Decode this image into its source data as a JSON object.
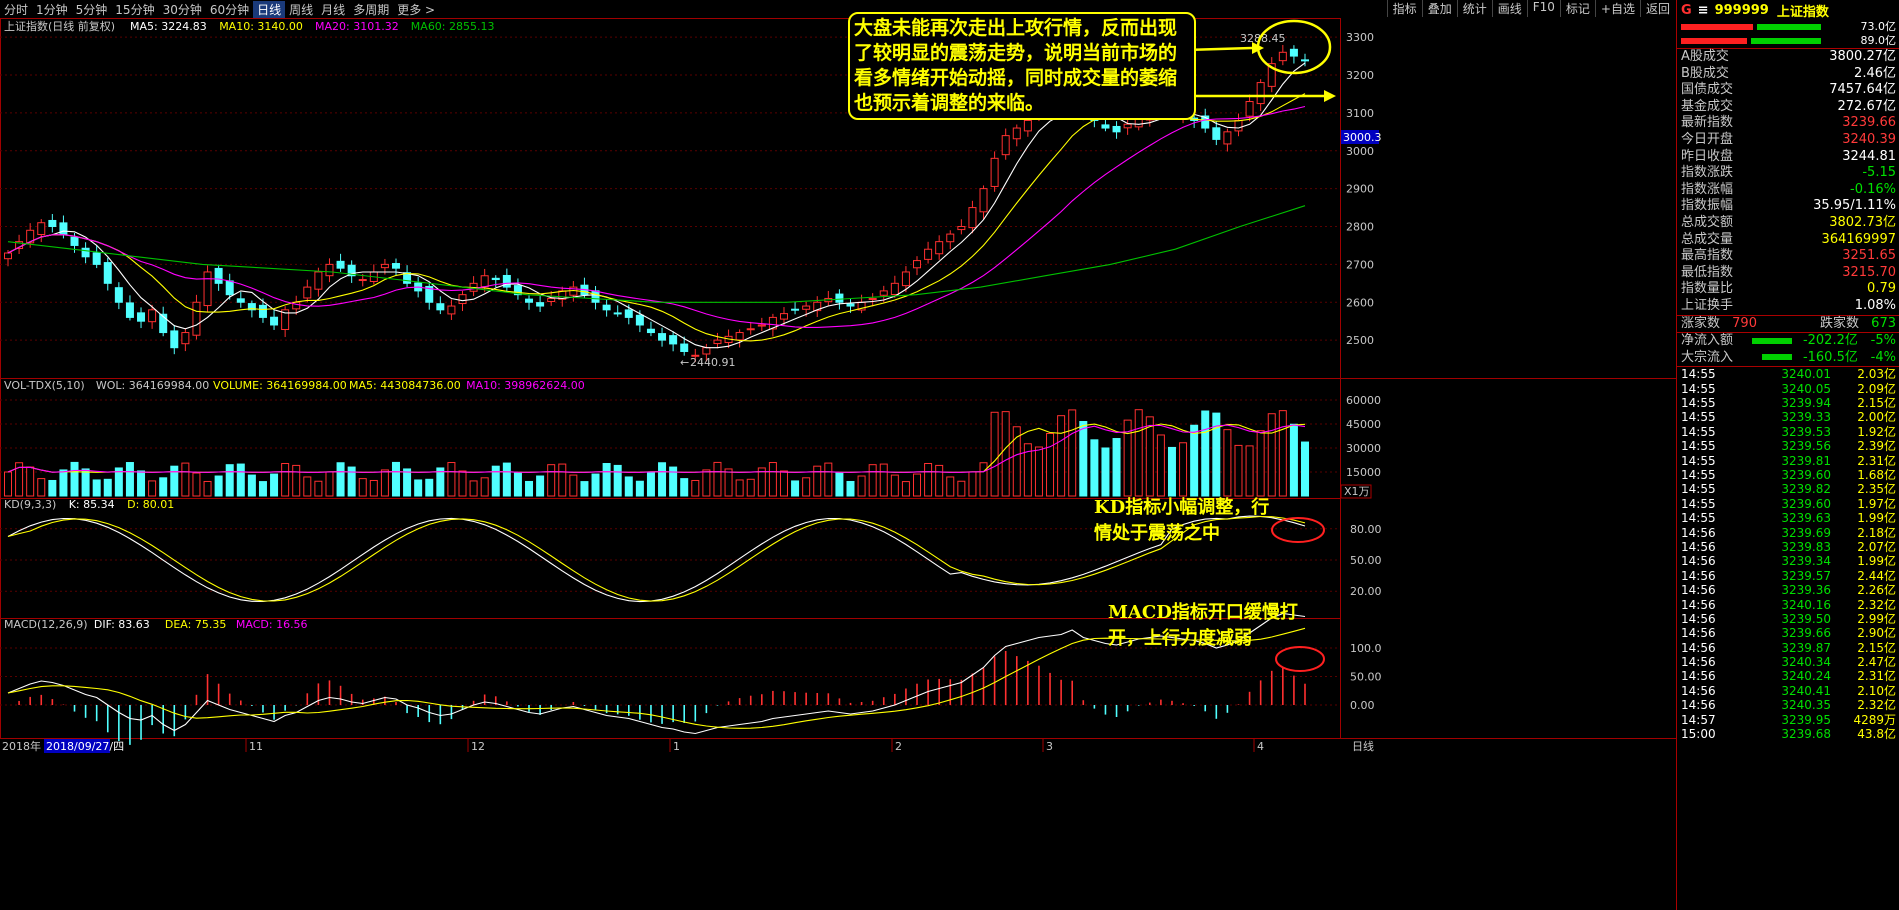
{
  "toolbar": {
    "left": [
      "分时",
      "1分钟",
      "5分钟",
      "15分钟",
      "30分钟",
      "60分钟",
      "日线",
      "周线",
      "月线",
      "多周期",
      "更多 >"
    ],
    "active_index": 6,
    "right": [
      "指标",
      "叠加",
      "统计",
      "画线",
      "F10",
      "标记",
      "+自选",
      "返回"
    ]
  },
  "main_chart": {
    "title": "上证指数(日线 前复权)",
    "ma_labels": [
      {
        "text": "MA5: 3224.83",
        "color": "#ffffff"
      },
      {
        "text": "MA10: 3140.00",
        "color": "#ffff00"
      },
      {
        "text": "MA20: 3101.32",
        "color": "#ff00ff"
      },
      {
        "text": "MA60: 2855.13",
        "color": "#00c000"
      }
    ],
    "y_ticks": [
      "3300",
      "3200",
      "3100",
      "3000",
      "2900",
      "2800",
      "2700",
      "2600",
      "2500"
    ],
    "low_label": "2440.91",
    "high_label": "3288.45",
    "price_marker": "3000.3"
  },
  "volume_chart": {
    "labels": [
      {
        "text": "VOL-TDX(5,10)",
        "color": "#c8c8c8"
      },
      {
        "text": "WOL: 364169984.00",
        "color": "#c8c8c8"
      },
      {
        "text": "VOLUME: 364169984.00",
        "color": "#ffff00"
      },
      {
        "text": "MA5: 443084736.00",
        "color": "#ffff00"
      },
      {
        "text": "MA10: 398962624.00",
        "color": "#ff00ff"
      }
    ],
    "y_ticks": [
      "60000",
      "45000",
      "30000",
      "15000"
    ],
    "unit": "X1万"
  },
  "kd_chart": {
    "labels": [
      {
        "text": "KD(9,3,3)",
        "color": "#c8c8c8"
      },
      {
        "text": "K: 85.34",
        "color": "#ffffff"
      },
      {
        "text": "D: 80.01",
        "color": "#ffff00"
      }
    ],
    "y_ticks": [
      "80.00",
      "50.00",
      "20.00"
    ]
  },
  "macd_chart": {
    "labels": [
      {
        "text": "MACD(12,26,9)",
        "color": "#c8c8c8"
      },
      {
        "text": "DIF: 83.63",
        "color": "#ffffff"
      },
      {
        "text": "DEA: 75.35",
        "color": "#ffff00"
      },
      {
        "text": "MACD: 16.56",
        "color": "#ff00ff"
      }
    ],
    "y_ticks": [
      "100.0",
      "50.00",
      "0.00"
    ]
  },
  "x_axis": {
    "year": "2018年",
    "cursor_date": "2018/09/27/四",
    "months": [
      "11",
      "12",
      "1",
      "2",
      "3",
      "4"
    ],
    "period": "日线"
  },
  "annotations": {
    "main": "大盘未能再次走出上攻行情，反而出现了较明显的震荡走势，说明当前市场的看多情绪开始动摇，同时成交量的萎缩也预示着调整的来临。",
    "kd": "KD指标小幅调整，行情处于震荡之中",
    "macd": "MACD指标开口缓慢打开，上行力度减弱"
  },
  "right_panel": {
    "code": "999999",
    "name": "上证指数",
    "g_label": "G",
    "eq": "≡",
    "bar_values": [
      "73.0亿",
      "89.0亿"
    ],
    "stats": [
      {
        "label": "A股成交",
        "value": "3800.27亿",
        "color": "white"
      },
      {
        "label": "B股成交",
        "value": "2.46亿",
        "color": "white"
      },
      {
        "label": "国债成交",
        "value": "7457.64亿",
        "color": "white"
      },
      {
        "label": "基金成交",
        "value": "272.67亿",
        "color": "white"
      },
      {
        "label": "最新指数",
        "value": "3239.66",
        "color": "red"
      },
      {
        "label": "今日开盘",
        "value": "3240.39",
        "color": "red"
      },
      {
        "label": "昨日收盘",
        "value": "3244.81",
        "color": "white"
      },
      {
        "label": "指数涨跌",
        "value": "-5.15",
        "color": "green"
      },
      {
        "label": "指数涨幅",
        "value": "-0.16%",
        "color": "green"
      },
      {
        "label": "指数振幅",
        "value": "35.95/1.11%",
        "color": "white"
      },
      {
        "label": "总成交额",
        "value": "3802.73亿",
        "color": "yellow"
      },
      {
        "label": "总成交量",
        "value": "364169997",
        "color": "yellow"
      },
      {
        "label": "最高指数",
        "value": "3251.65",
        "color": "red"
      },
      {
        "label": "最低指数",
        "value": "3215.70",
        "color": "red"
      },
      {
        "label": "指数量比",
        "value": "0.79",
        "color": "yellow"
      },
      {
        "label": "上证换手",
        "value": "1.08%",
        "color": "white"
      }
    ],
    "up_label": "涨家数",
    "up_value": "790",
    "down_label": "跌家数",
    "down_value": "673",
    "flows": [
      {
        "label": "净流入额",
        "value": "-202.2亿",
        "pct": "-5%"
      },
      {
        "label": "大宗流入",
        "value": "-160.5亿",
        "pct": "-4%"
      }
    ],
    "ticks": [
      {
        "t": "14:55",
        "p": "3240.01",
        "v": "2.03亿"
      },
      {
        "t": "14:55",
        "p": "3240.05",
        "v": "2.09亿"
      },
      {
        "t": "14:55",
        "p": "3239.94",
        "v": "2.15亿"
      },
      {
        "t": "14:55",
        "p": "3239.33",
        "v": "2.00亿"
      },
      {
        "t": "14:55",
        "p": "3239.53",
        "v": "1.92亿"
      },
      {
        "t": "14:55",
        "p": "3239.56",
        "v": "2.39亿"
      },
      {
        "t": "14:55",
        "p": "3239.81",
        "v": "2.31亿"
      },
      {
        "t": "14:55",
        "p": "3239.60",
        "v": "1.68亿"
      },
      {
        "t": "14:55",
        "p": "3239.82",
        "v": "2.35亿"
      },
      {
        "t": "14:55",
        "p": "3239.60",
        "v": "1.97亿"
      },
      {
        "t": "14:55",
        "p": "3239.63",
        "v": "1.99亿"
      },
      {
        "t": "14:56",
        "p": "3239.69",
        "v": "2.18亿"
      },
      {
        "t": "14:56",
        "p": "3239.83",
        "v": "2.07亿"
      },
      {
        "t": "14:56",
        "p": "3239.34",
        "v": "1.99亿"
      },
      {
        "t": "14:56",
        "p": "3239.57",
        "v": "2.44亿"
      },
      {
        "t": "14:56",
        "p": "3239.36",
        "v": "2.26亿"
      },
      {
        "t": "14:56",
        "p": "3240.16",
        "v": "2.32亿"
      },
      {
        "t": "14:56",
        "p": "3239.50",
        "v": "2.99亿"
      },
      {
        "t": "14:56",
        "p": "3239.66",
        "v": "2.90亿"
      },
      {
        "t": "14:56",
        "p": "3239.87",
        "v": "2.15亿"
      },
      {
        "t": "14:56",
        "p": "3240.34",
        "v": "2.47亿"
      },
      {
        "t": "14:56",
        "p": "3240.24",
        "v": "2.31亿"
      },
      {
        "t": "14:56",
        "p": "3240.41",
        "v": "2.10亿"
      },
      {
        "t": "14:56",
        "p": "3240.35",
        "v": "2.32亿"
      },
      {
        "t": "14:57",
        "p": "3239.95",
        "v": "4289万"
      },
      {
        "t": "15:00",
        "p": "3239.68",
        "v": "43.8亿"
      }
    ]
  },
  "chart_data": {
    "type": "candlestick",
    "title": "上证指数(日线 前复权)",
    "ylim": [
      2400,
      3340
    ],
    "candles": [],
    "indicators": [
      "MA5",
      "MA10",
      "MA20",
      "MA60",
      "VOL-TDX(5,10)",
      "KD(9,3,3)",
      "MACD(12,26,9)"
    ],
    "series_closes": [
      2730,
      2760,
      2790,
      2810,
      2800,
      2780,
      2750,
      2720,
      2700,
      2650,
      2600,
      2560,
      2550,
      2580,
      2520,
      2480,
      2520,
      2600,
      2680,
      2650,
      2620,
      2600,
      2580,
      2560,
      2540,
      2580,
      2600,
      2640,
      2680,
      2700,
      2690,
      2670,
      2660,
      2680,
      2700,
      2690,
      2650,
      2630,
      2600,
      2580,
      2590,
      2620,
      2650,
      2670,
      2660,
      2640,
      2620,
      2600,
      2590,
      2610,
      2630,
      2640,
      2620,
      2600,
      2580,
      2570,
      2560,
      2540,
      2520,
      2500,
      2490,
      2470,
      2460,
      2480,
      2500,
      2510,
      2520,
      2530,
      2540,
      2560,
      2570,
      2580,
      2590,
      2600,
      2610,
      2600,
      2590,
      2600,
      2610,
      2630,
      2650,
      2680,
      2710,
      2740,
      2760,
      2780,
      2800,
      2850,
      2900,
      2980,
      3040,
      3060,
      3080,
      3100,
      3110,
      3120,
      3150,
      3100,
      3080,
      3060,
      3050,
      3070,
      3090,
      3100,
      3110,
      3100,
      3090,
      3080,
      3060,
      3030,
      3050,
      3080,
      3130,
      3180,
      3230,
      3260,
      3250,
      3240
    ],
    "ma60_values": [
      2760,
      2740,
      2720,
      2700,
      2690,
      2680,
      2660,
      2640,
      2620,
      2610,
      2600,
      2600,
      2600,
      2610,
      2620,
      2640,
      2670,
      2700,
      2740,
      2800,
      2855
    ]
  }
}
